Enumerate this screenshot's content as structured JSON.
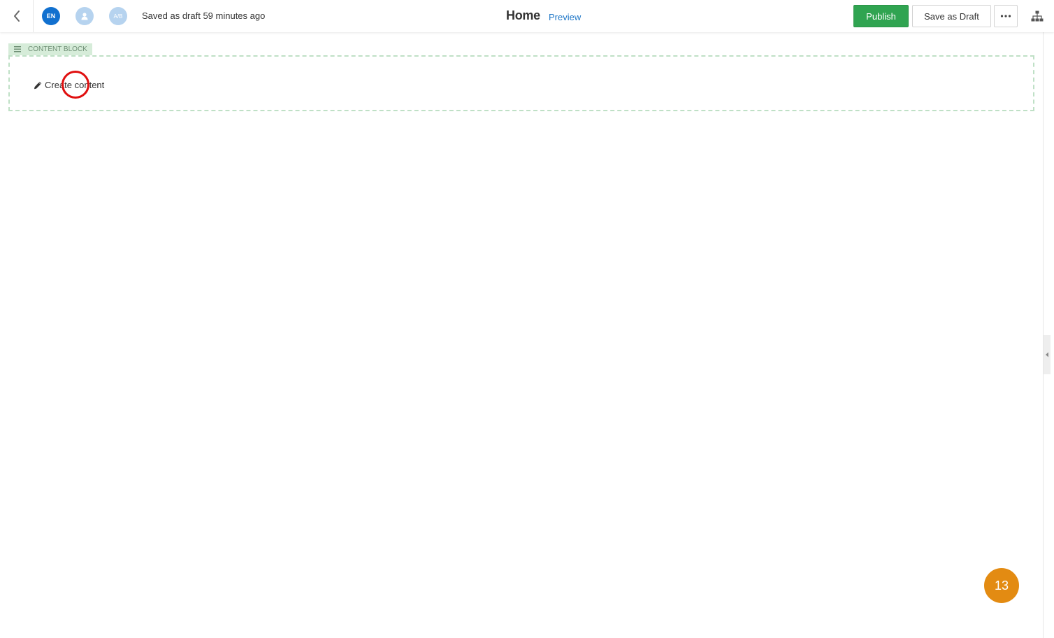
{
  "topbar": {
    "language_code": "EN",
    "ab_label": "A/B",
    "saved_status": "Saved as draft 59 minutes ago",
    "page_title": "Home",
    "preview_label": "Preview",
    "publish_label": "Publish",
    "save_draft_label": "Save as Draft",
    "icons": {
      "back": "chevron-left-icon",
      "persona": "user-icon",
      "more": "ellipsis-icon",
      "sitemap": "sitemap-icon"
    }
  },
  "content_block": {
    "label": "CONTENT BLOCK",
    "create_label": "Create content",
    "icons": {
      "handle": "drag-handle-icon",
      "edit": "pencil-icon"
    }
  },
  "step_badge": "13",
  "colors": {
    "publish_green": "#30a451",
    "link_blue": "#1f77c7",
    "language_blue": "#1170cf",
    "block_green": "#d6ecd9",
    "badge_orange": "#e38b12",
    "marker_red": "#e01010"
  }
}
